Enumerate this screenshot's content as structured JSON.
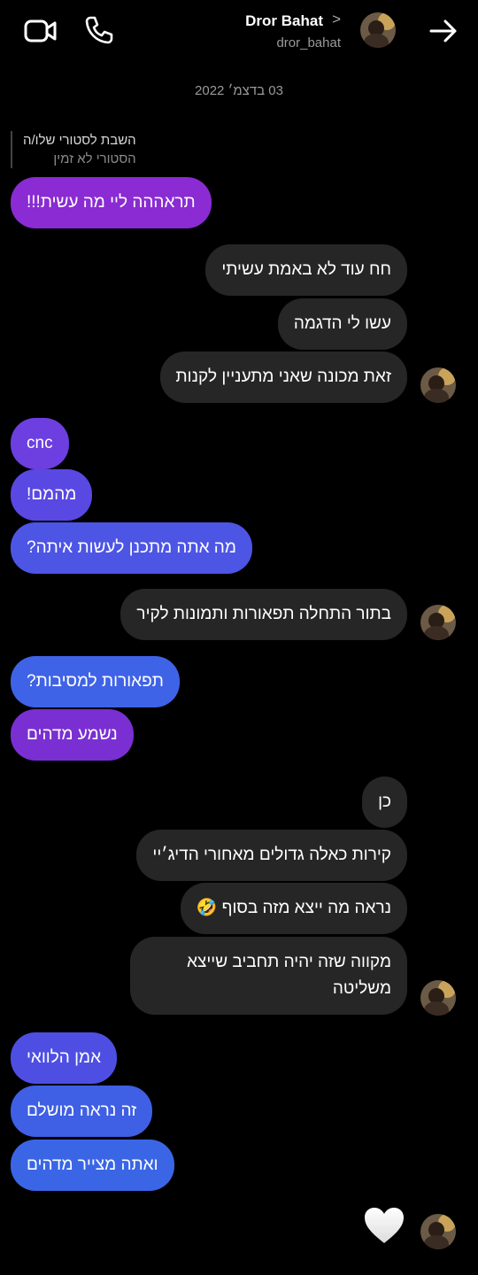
{
  "header": {
    "name": "Dror Bahat",
    "username": "dror_bahat",
    "chevron": ">"
  },
  "date": "03 בדצמ׳ 2022",
  "reply": {
    "line1": "השבת לסטורי שלו/ה",
    "line2": "הסטורי לא זמין"
  },
  "messages": [
    {
      "text": "תראההה ליי מה עשית!!!",
      "from": "me",
      "color": "#8a2bd3"
    },
    {
      "text": "חח עוד לא באמת עשיתי",
      "from": "them"
    },
    {
      "text": "עשו לי הדגמה",
      "from": "them"
    },
    {
      "text": "זאת מכונה שאני מתעניין לקנות",
      "from": "them"
    },
    {
      "text": "cnc",
      "from": "me",
      "color": "#6d3fe0"
    },
    {
      "text": "מהמם!",
      "from": "me",
      "color": "#5a48e3"
    },
    {
      "text": "מה אתה מתכנן לעשות איתה?",
      "from": "me",
      "color": "#4d55e5"
    },
    {
      "text": "בתור התחלה תפאורות ותמונות לקיר",
      "from": "them"
    },
    {
      "text": "תפאורות למסיבות?",
      "from": "me",
      "color": "#3f63e6"
    },
    {
      "text": "נשמע מדהים",
      "from": "me",
      "color": "#7a2fd2"
    },
    {
      "text": "כן",
      "from": "them"
    },
    {
      "text": "קירות כאלה גדולים מאחורי הדיג׳יי",
      "from": "them"
    },
    {
      "text": "נראה מה ייצא מזה בסוף 🤣",
      "from": "them"
    },
    {
      "text": "מקווה שזה יהיה תחביב שייצא משליטה",
      "from": "them"
    },
    {
      "text": "אמן הלוואי",
      "from": "me",
      "color": "#4e4fe2"
    },
    {
      "text": "זה נראה מושלם",
      "from": "me",
      "color": "#3f5fe4"
    },
    {
      "text": "ואתה מצייר מדהים",
      "from": "me",
      "color": "#3a66e6"
    }
  ],
  "reaction": "white-heart",
  "icons": [
    "video-call-icon",
    "phone-icon",
    "back-arrow-icon"
  ]
}
